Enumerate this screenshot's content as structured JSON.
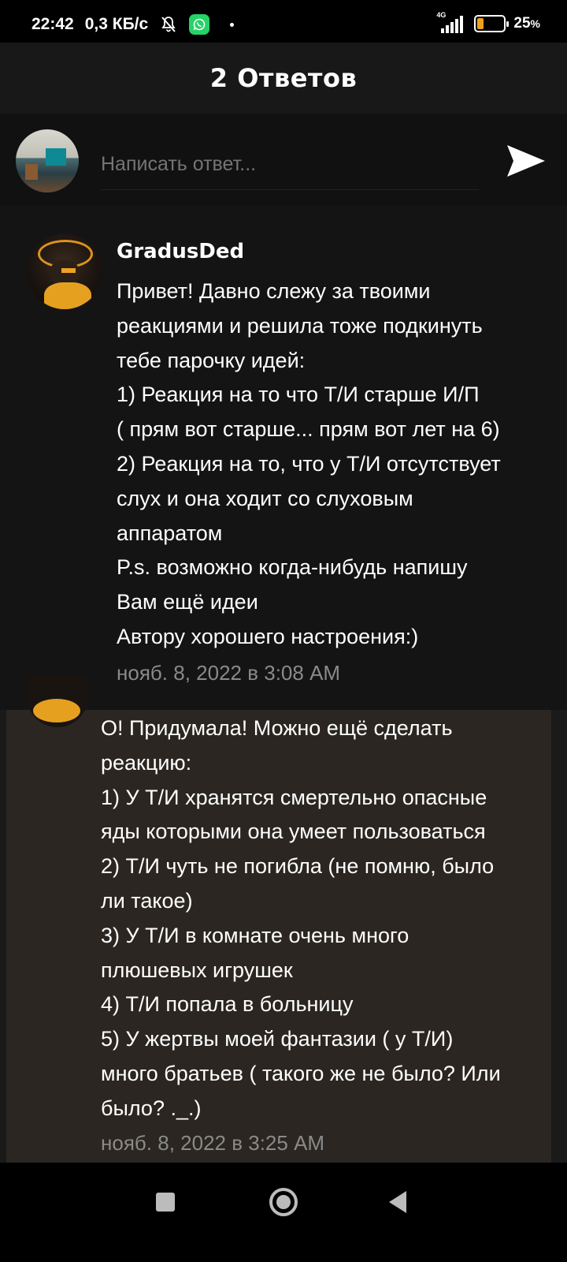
{
  "status_bar": {
    "time": "22:42",
    "net_speed": "0,3 КБ/с",
    "network_type": "4G",
    "battery_percent": "25",
    "battery_suffix": "%",
    "battery_level": 0.25,
    "icons": [
      "mute-bell-icon",
      "whatsapp-icon",
      "signal-icon",
      "battery-icon"
    ]
  },
  "header": {
    "title": "2 Ответов"
  },
  "reply": {
    "placeholder": "Написать ответ...",
    "send_icon": "send-icon"
  },
  "comments": [
    {
      "author": "GradusDed",
      "text": "Привет! Давно слежу за твоими\nреакциями и решила тоже подкинуть\nтебе парочку идей:\n1) Реакция на то что Т/И старше И/П\n( прям вот старше... прям вот лет на 6)\n2) Реакция на то, что у Т/И отсутствует\nслух и она ходит со слуховым\nаппаратом\nP.s. возможно когда-нибудь напишу\nВам ещё идеи\nАвтору хорошего настроения:)",
      "timestamp": "нояб. 8, 2022 в 3:08 AM"
    },
    {
      "author": "",
      "text": "О! Придумала! Можно ещё сделать\nреакцию:\n1) У Т/И хранятся смертельно опасные\nяды которыми она умеет пользоваться\n2) Т/И чуть не погибла (не помню, было\nли такое)\n3) У Т/И в комнате очень много\nплюшевых игрушек\n4) Т/И попала в больницу\n5) У жертвы моей фантазии ( у Т/И)\nмного братьев ( такого же не было? Или\nбыло? ._.)",
      "timestamp": "нояб. 8, 2022 в 3:25 AM"
    }
  ],
  "colors": {
    "background": "#1a1a1a",
    "highlight_comment": "#2b2621",
    "timestamp": "#8a8a8a",
    "placeholder": "#9a9a9a"
  }
}
